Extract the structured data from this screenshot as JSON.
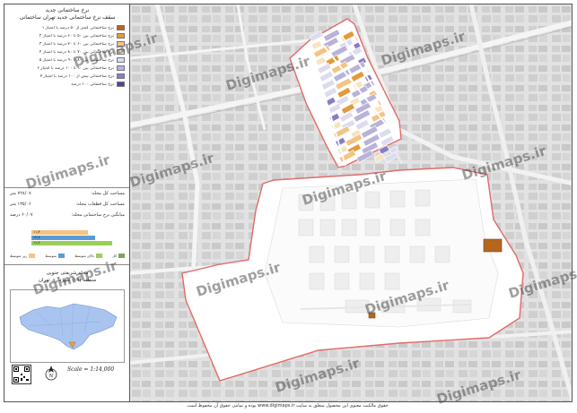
{
  "legend": {
    "title_line1": "نرخ ساختمانی جدید",
    "title_line2": "سقف نرخ ساختمانی جدید تهران ساختمانی",
    "items": [
      {
        "label": "نرخ ساختمانی کمتر از ۵۰ درصد با امتیاز ۱",
        "color": "#b5651d"
      },
      {
        "label": "نرخ ساختمانی بین ۵۰ تا ۶۰ درصد با امتیاز ۲",
        "color": "#e39a3b"
      },
      {
        "label": "نرخ ساختمانی بین ۶۰ تا ۷۰ درصد با امتیاز ۳",
        "color": "#f3c483"
      },
      {
        "label": "نرخ ساختمانی بین ۷۰ تا ۸۰ درصد با امتیاز ۴",
        "color": "#f7e3c0"
      },
      {
        "label": "نرخ ساختمانی بین ۸۰ تا ۹۰ درصد با امتیاز ۵",
        "color": "#dcdcef"
      },
      {
        "label": "نرخ ساختمانی بین ۹۰ تا ۱۰۰ درصد با امتیاز ۶",
        "color": "#b9b3da"
      },
      {
        "label": "نرخ ساختمانی بیش از ۱۰۰ درصد با امتیاز ۷",
        "color": "#8a7cc0"
      },
      {
        "label": "نرخ ساختمانی ۱۰۰ درصد",
        "color": "#5a3f96"
      }
    ]
  },
  "stats": [
    {
      "label": "مساحت کل محله:",
      "value": "۷۲۸/۰۷ متر"
    },
    {
      "label": "مساحت کل قطعات محله:",
      "value": "۱۳۵/۰۶ متر"
    },
    {
      "label": "میانگین نرخ ساختمانی محله:",
      "value": "۶۰/۰۷ درصد"
    }
  ],
  "chart_data": {
    "type": "bar",
    "categories": [
      "",
      "",
      ""
    ],
    "series": [
      {
        "name": "",
        "values": [
          11.3
        ]
      },
      {
        "name": "",
        "values": [
          12.8
        ]
      },
      {
        "name": "",
        "values": [
          16.2
        ]
      }
    ],
    "labels": [
      "۱۱٫۳",
      "۱۲٫۸",
      "۱۶٫۲"
    ],
    "colors": [
      "#f3c483",
      "#5b9bd5",
      "#9acd5a"
    ]
  },
  "keys": [
    {
      "label": "زیر متوسط",
      "color": "#f3c483"
    },
    {
      "label": "متوسط",
      "color": "#5b9bd5"
    },
    {
      "label": "بالای متوسط",
      "color": "#9acd5a"
    },
    {
      "label": "کل",
      "color": "#7ba75b"
    }
  ],
  "region": {
    "line1": "محله شریعتی جنوبی",
    "line2": "منطقه (۱۹) شهرداری تهران"
  },
  "scale": "Scale = 1:14,000",
  "watermarks": [
    "Digimaps.ir",
    "Digimaps.ir",
    "Digimaps.ir",
    "Digimaps.ir",
    "Digimaps.ir",
    "Digimaps.ir",
    "Digimaps.ir",
    "Digimaps.ir",
    "Digimaps.ir",
    "Digimaps.ir",
    "Digimaps.ir",
    "Digimaps.ir",
    "Digimaps.ir"
  ],
  "footer": "حقوق مالکیت معنوی این محصول متعلق به سایت www.digimaps.ir بوده و تمامی حقوق آن محفوظ است."
}
